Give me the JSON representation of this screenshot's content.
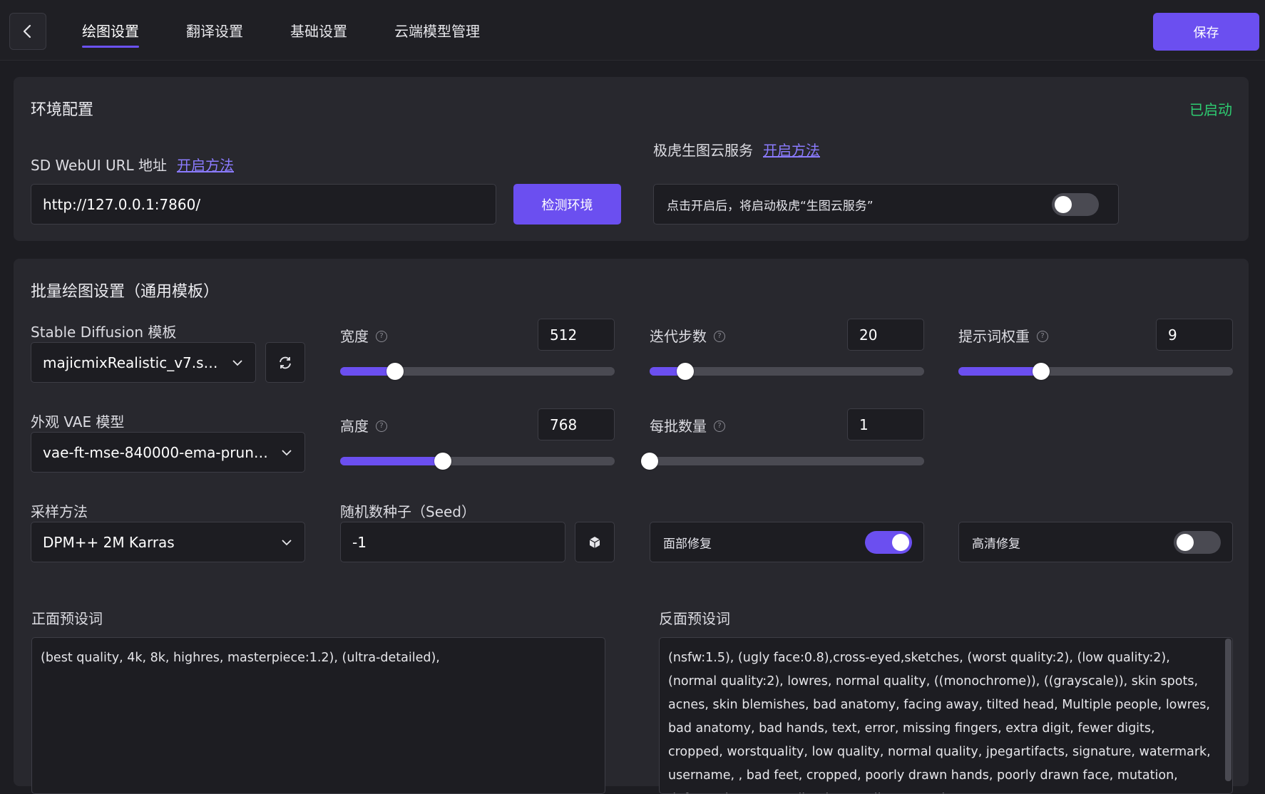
{
  "nav": {
    "tabs": [
      "绘图设置",
      "翻译设置",
      "基础设置",
      "云端模型管理"
    ],
    "save_label": "保存"
  },
  "env": {
    "title": "环境配置",
    "status": "已启动",
    "status_color": "#2ecc71",
    "sd_url_label": "SD WebUI URL 地址",
    "sd_url_link": "开启方法",
    "sd_url_value": "http://127.0.0.1:7860/",
    "check_button": "检测环境",
    "cloud_label": "极虎生图云服务",
    "cloud_link": "开启方法",
    "cloud_toggle_text": "点击开启后，将启动极虎“生图云服务”",
    "cloud_toggle_on": false
  },
  "batch": {
    "title": "批量绘图设置（通用模板）",
    "sd_model_label": "Stable Diffusion 模板",
    "sd_model_value": "majicmixRealistic_v7.saf...",
    "vae_label": "外观 VAE 模型",
    "vae_value": "vae-ft-mse-840000-ema-prune...",
    "sampler_label": "采样方法",
    "sampler_value": "DPM++ 2M Karras",
    "width": {
      "label": "宽度",
      "value": "512",
      "fill": 0.2
    },
    "height": {
      "label": "高度",
      "value": "768",
      "fill": 0.375
    },
    "steps": {
      "label": "迭代步数",
      "value": "20",
      "fill": 0.13
    },
    "batch_count": {
      "label": "每批数量",
      "value": "1",
      "fill": 0.0
    },
    "cfg": {
      "label": "提示词权重",
      "value": "9",
      "fill": 0.3
    },
    "seed_label": "随机数种子（Seed）",
    "seed_value": "-1",
    "face_fix": {
      "label": "面部修复",
      "on": true
    },
    "hires_fix": {
      "label": "高清修复",
      "on": false
    },
    "accent": "#6b4ff0"
  },
  "prompts": {
    "positive_label": "正面预设词",
    "positive_text": "(best quality, 4k, 8k, highres, masterpiece:1.2), (ultra-detailed),",
    "negative_label": "反面预设词",
    "negative_text": "(nsfw:1.5), (ugly face:0.8),cross-eyed,sketches, (worst quality:2), (low quality:2), (normal quality:2), lowres, normal quality, ((monochrome)), ((grayscale)), skin spots, acnes, skin blemishes, bad anatomy, facing away, tilted head, Multiple people, lowres, bad anatomy, bad hands, text, error, missing fingers, extra digit, fewer digits, cropped, worstquality, low quality, normal quality, jpegartifacts, signature, watermark, username, , bad feet, cropped, poorly drawn hands, poorly drawn face, mutation, deformed, worst quality, low quality, normal"
  }
}
